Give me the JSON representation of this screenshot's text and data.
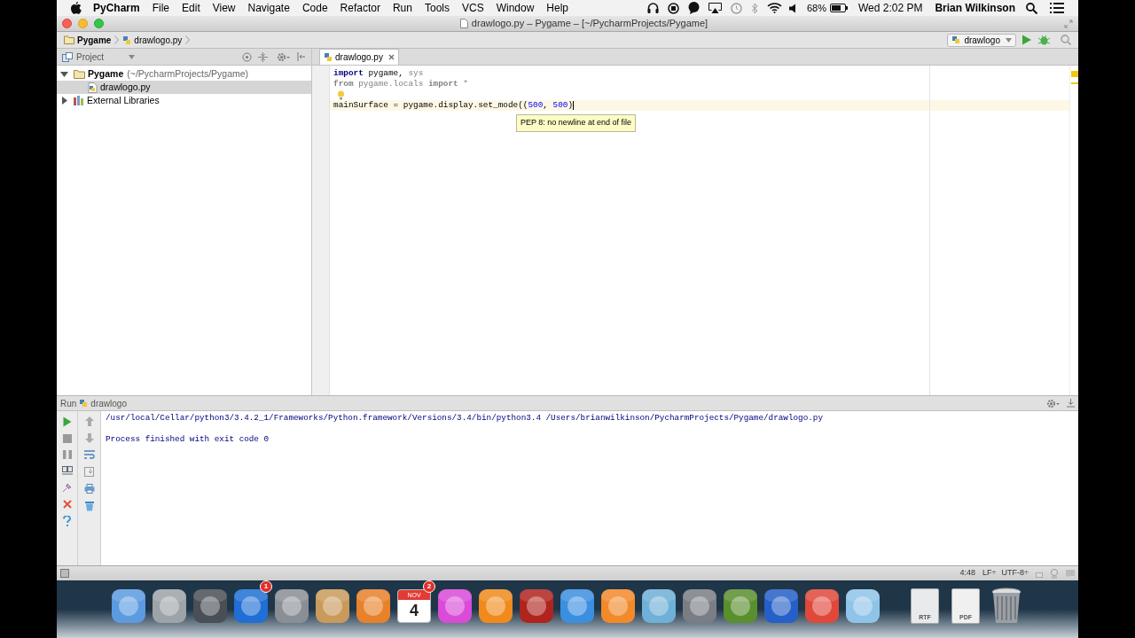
{
  "menu_bar": {
    "app": "PyCharm",
    "items": [
      "File",
      "Edit",
      "View",
      "Navigate",
      "Code",
      "Refactor",
      "Run",
      "Tools",
      "VCS",
      "Window",
      "Help"
    ],
    "battery": "68%",
    "clock": "Wed 2:02 PM",
    "user": "Brian Wilkinson"
  },
  "window": {
    "title": "drawlogo.py – Pygame – [~/PycharmProjects/Pygame]"
  },
  "breadcrumbs": [
    "Pygame",
    "drawlogo.py"
  ],
  "run_config": "drawlogo",
  "project_panel": {
    "title": "Project",
    "tree": [
      {
        "label": "Pygame",
        "path": "(~/PycharmProjects/Pygame)",
        "kind": "folder",
        "expanded": true,
        "selected": false,
        "children": [
          {
            "label": "drawlogo.py",
            "kind": "python",
            "selected": true
          }
        ]
      },
      {
        "label": "External Libraries",
        "kind": "library",
        "expanded": false,
        "selected": false
      }
    ]
  },
  "editor": {
    "tabs": [
      {
        "label": "drawlogo.py",
        "selected": true
      }
    ],
    "lines": [
      {
        "current": false,
        "tokens": [
          {
            "kind": "keyword",
            "text": "import"
          },
          {
            "kind": "text",
            "text": " pygame,"
          },
          {
            "kind": "unused",
            "text": " sys"
          }
        ]
      },
      {
        "current": false,
        "tokens": [
          {
            "kind": "unused_keyword",
            "text": "from"
          },
          {
            "kind": "unused",
            "text": " pygame.locals "
          },
          {
            "kind": "unused_keyword",
            "text": "import"
          },
          {
            "kind": "unused",
            "text": " *"
          }
        ]
      },
      {
        "current": false,
        "bulb": true
      },
      {
        "current": true,
        "tokens": [
          {
            "kind": "text",
            "text": "mainSurface = pygame.display.set_mode(("
          },
          {
            "kind": "number",
            "text": "500"
          },
          {
            "kind": "text",
            "text": ", "
          },
          {
            "kind": "number",
            "text": "500"
          },
          {
            "kind": "text",
            "text": ")"
          }
        ]
      }
    ],
    "tooltip": "PEP 8: no newline at end of file"
  },
  "run_panel": {
    "title": "Run",
    "config": "drawlogo",
    "output": [
      "/usr/local/Cellar/python3/3.4.2_1/Frameworks/Python.framework/Versions/3.4/bin/python3.4 /Users/brianwilkinson/PycharmProjects/Pygame/drawlogo.py",
      "Process finished with exit code 0"
    ]
  },
  "status_bar": {
    "position": "4:48",
    "line_separator": "LF÷",
    "encoding": "UTF-8÷"
  },
  "dock": [
    {
      "kind": "app",
      "color": "#5b9be0"
    },
    {
      "kind": "app",
      "color": "#9ea3a8"
    },
    {
      "kind": "app",
      "color": "#4a4f57"
    },
    {
      "kind": "app",
      "color": "#1f6fd6",
      "badge": "1"
    },
    {
      "kind": "app",
      "color": "#8a8f95"
    },
    {
      "kind": "app",
      "color": "#c99a5a"
    },
    {
      "kind": "app",
      "color": "#e8812a"
    },
    {
      "kind": "calendar",
      "color": "#e23b36",
      "month": "NOV",
      "day": "4",
      "badge": "2"
    },
    {
      "kind": "app",
      "color": "#d94bd8"
    },
    {
      "kind": "app",
      "color": "#f08a1c"
    },
    {
      "kind": "app",
      "color": "#b0241e"
    },
    {
      "kind": "app",
      "color": "#3b8fe0"
    },
    {
      "kind": "app",
      "color": "#f2892a"
    },
    {
      "kind": "app",
      "color": "#6fb0d8"
    },
    {
      "kind": "app",
      "color": "#7a7e84"
    },
    {
      "kind": "app",
      "color": "#5a8f2e"
    },
    {
      "kind": "app",
      "color": "#2560c8"
    },
    {
      "kind": "app",
      "color": "#e0483a"
    },
    {
      "kind": "app",
      "color": "#8fc3e8"
    },
    {
      "kind": "document",
      "color": "#e8eaec",
      "label": "RTF"
    },
    {
      "kind": "document",
      "color": "#f0f0f0",
      "label": "PDF"
    },
    {
      "kind": "trash",
      "color": "#9aa0a6"
    }
  ]
}
